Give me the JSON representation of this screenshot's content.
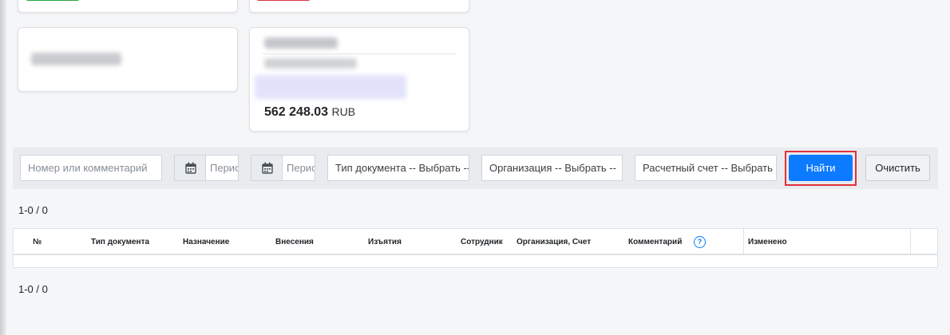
{
  "summary": {
    "balance_amount": "562 248.03",
    "balance_currency": "RUB"
  },
  "filters": {
    "number_placeholder": "Номер или комментарий",
    "period_from_placeholder": "Период с",
    "period_to_placeholder": "Период по",
    "doc_type_placeholder": "Тип документа -- Выбрать --",
    "organization_placeholder": "Организация -- Выбрать --",
    "account_placeholder": "Расчетный счет -- Выбрать --",
    "find_label": "Найти",
    "clear_label": "Очистить"
  },
  "pager": {
    "top": "1-0 / 0",
    "bottom": "1-0 / 0"
  },
  "table": {
    "columns": {
      "num": "№",
      "doc_type": "Тип документа",
      "purpose": "Назначение",
      "deposits": "Внесения",
      "withdrawals": "Изъятия",
      "employee": "Сотрудник",
      "org_account": "Организация, Счет",
      "comment": "Комментарий",
      "modified": "Изменено"
    },
    "help_glyph": "?"
  },
  "icons": {
    "calendar": "calendar-icon",
    "help": "help-circle-icon"
  },
  "colors": {
    "primary": "#0d7bff",
    "success": "#28a745",
    "danger": "#dc3545",
    "highlight": "#e0313a"
  }
}
